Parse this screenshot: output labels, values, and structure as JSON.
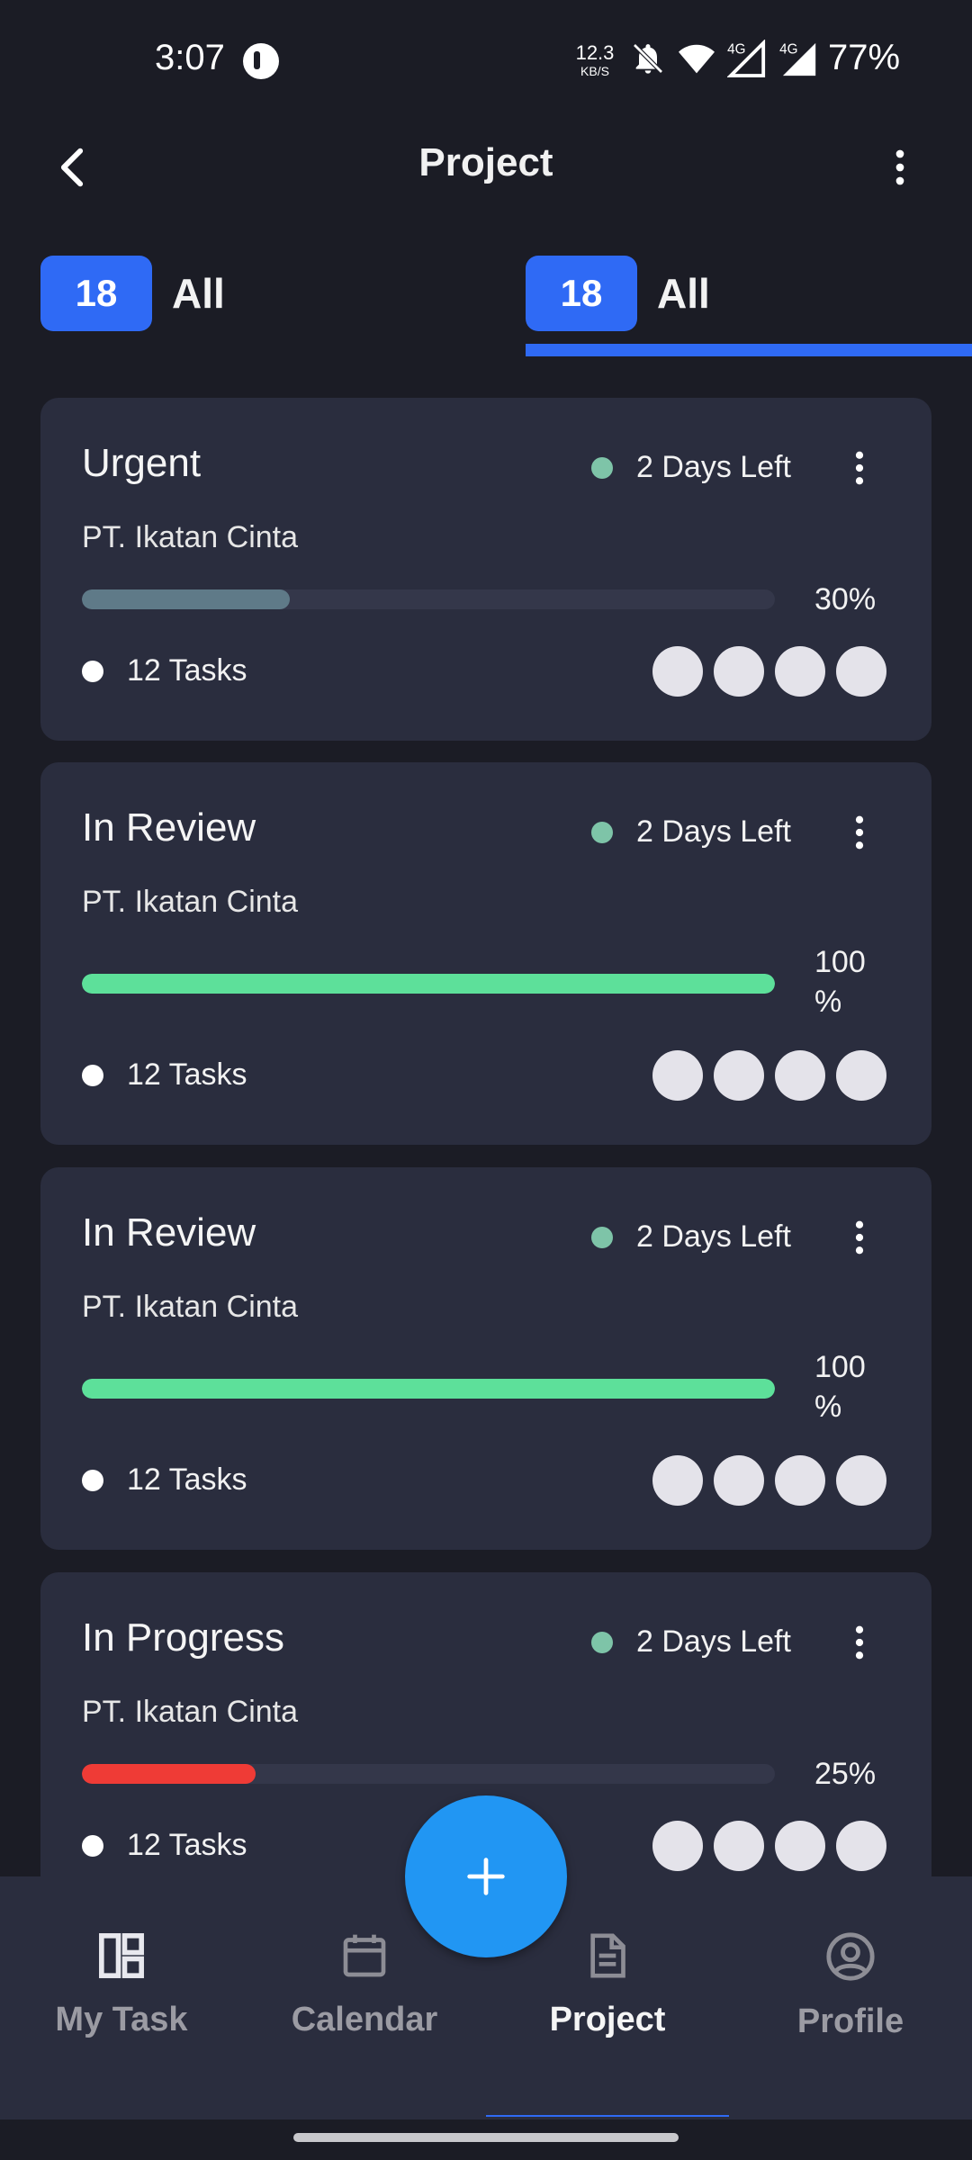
{
  "status_bar": {
    "time": "3:07",
    "net_speed_value": "12.3",
    "net_speed_unit": "KB/S",
    "network_1": "4G",
    "network_2": "4G",
    "battery": "77%"
  },
  "header": {
    "title": "Project"
  },
  "tabs": [
    {
      "count": "18",
      "label": "All",
      "active": false
    },
    {
      "count": "18",
      "label": "All",
      "active": true
    }
  ],
  "cards": [
    {
      "title": "Urgent",
      "days_left": "2 Days Left",
      "company": "PT. Ikatan Cinta",
      "progress": 0.3,
      "progress_text": "30%",
      "progress_color": "#5f7a88",
      "tasks": "12 Tasks"
    },
    {
      "title": "In Review",
      "days_left": "2 Days Left",
      "company": "PT. Ikatan Cinta",
      "progress": 1.0,
      "progress_text": "100 %",
      "progress_color": "#5de09a",
      "tasks": "12 Tasks"
    },
    {
      "title": "In Review",
      "days_left": "2 Days Left",
      "company": "PT. Ikatan Cinta",
      "progress": 1.0,
      "progress_text": "100 %",
      "progress_color": "#5de09a",
      "tasks": "12 Tasks"
    },
    {
      "title": "In Progress",
      "days_left": "2 Days Left",
      "company": "PT. Ikatan Cinta",
      "progress": 0.25,
      "progress_text": "25%",
      "progress_color": "#ef3b36",
      "tasks": "12 Tasks"
    }
  ],
  "bottom_nav": {
    "items": [
      {
        "label": "My Task",
        "icon": "dashboard-icon"
      },
      {
        "label": "Calendar",
        "icon": "calendar-icon"
      },
      {
        "label": "Project",
        "icon": "document-icon",
        "active": true
      },
      {
        "label": "Profile",
        "icon": "user-circle-icon"
      }
    ]
  },
  "fab": {
    "icon": "plus-icon"
  },
  "colors": {
    "background": "#1b1c25",
    "card": "#2a2d3e",
    "accent": "#2f6af5",
    "fab": "#2196f3",
    "status_dot": "#7ec4a8"
  }
}
